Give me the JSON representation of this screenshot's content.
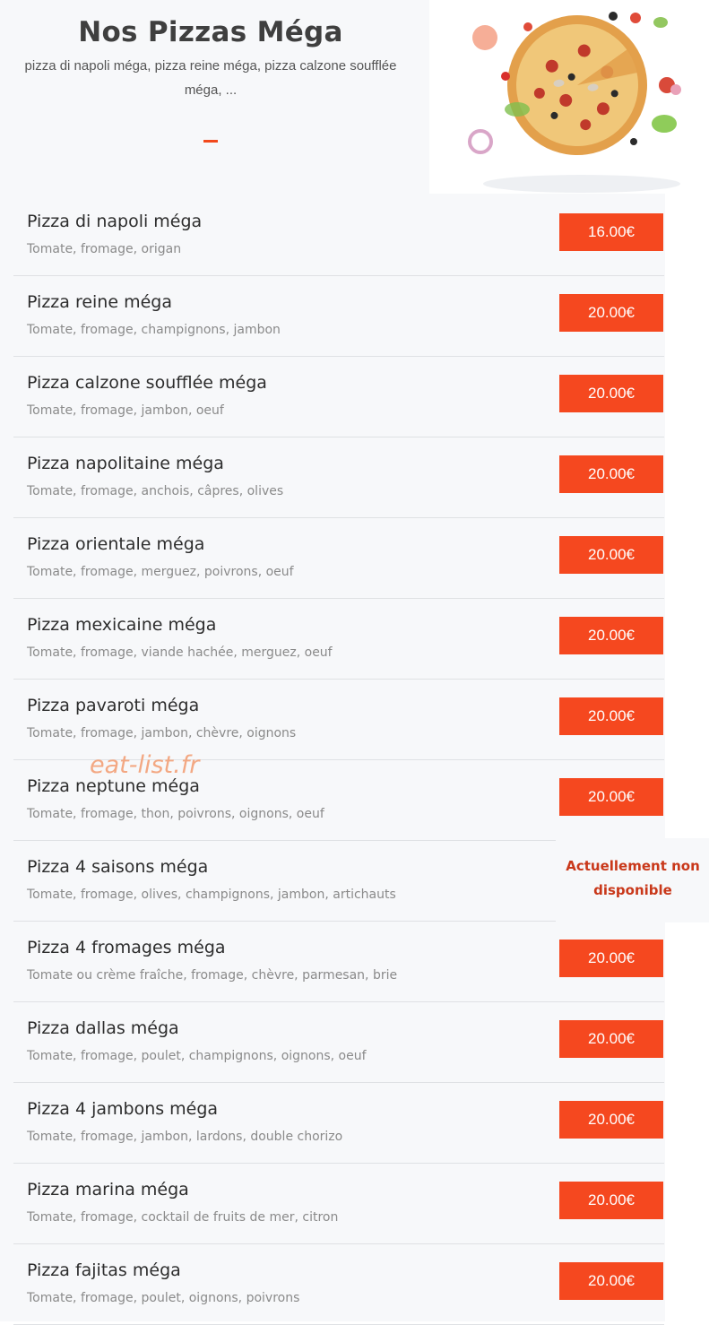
{
  "header": {
    "title": "Nos Pizzas Méga",
    "subtitle": "pizza di napoli méga, pizza reine méga, pizza calzone soufflée méga, ..."
  },
  "colors": {
    "accent": "#f5481f",
    "panel_bg": "#f7f8fa",
    "unavailable_text": "#c9381a"
  },
  "hero_image": "pizza-with-flying-ingredients",
  "watermark": "eat-list.fr",
  "items": [
    {
      "name": "Pizza di napoli méga",
      "desc": "Tomate, fromage, origan",
      "price": "16.00€"
    },
    {
      "name": "Pizza reine méga",
      "desc": "Tomate, fromage, champignons, jambon",
      "price": "20.00€"
    },
    {
      "name": "Pizza calzone soufflée méga",
      "desc": "Tomate, fromage, jambon, oeuf",
      "price": "20.00€"
    },
    {
      "name": "Pizza napolitaine méga",
      "desc": "Tomate, fromage, anchois, câpres, olives",
      "price": "20.00€"
    },
    {
      "name": "Pizza orientale méga",
      "desc": "Tomate, fromage, merguez, poivrons, oeuf",
      "price": "20.00€"
    },
    {
      "name": "Pizza mexicaine méga",
      "desc": "Tomate, fromage, viande hachée, merguez, oeuf",
      "price": "20.00€"
    },
    {
      "name": "Pizza pavaroti méga",
      "desc": "Tomate, fromage, jambon, chèvre, oignons",
      "price": "20.00€"
    },
    {
      "name": "Pizza neptune méga",
      "desc": "Tomate, fromage, thon, poivrons, oignons, oeuf",
      "price": "20.00€"
    },
    {
      "name": "Pizza 4 saisons méga",
      "desc": "Tomate, fromage, olives, champignons, jambon, artichauts",
      "status_line1": "Actuellement non",
      "status_line2": "disponible"
    },
    {
      "name": "Pizza 4 fromages méga",
      "desc": "Tomate ou crème fraîche, fromage, chèvre, parmesan, brie",
      "price": "20.00€"
    },
    {
      "name": "Pizza dallas méga",
      "desc": "Tomate, fromage, poulet, champignons, oignons, oeuf",
      "price": "20.00€"
    },
    {
      "name": "Pizza 4 jambons méga",
      "desc": "Tomate, fromage, jambon, lardons, double chorizo",
      "price": "20.00€"
    },
    {
      "name": "Pizza marina méga",
      "desc": "Tomate, fromage, cocktail de fruits de mer, citron",
      "price": "20.00€"
    },
    {
      "name": "Pizza fajitas méga",
      "desc": "Tomate, fromage, poulet, oignons, poivrons",
      "price": "20.00€"
    }
  ]
}
